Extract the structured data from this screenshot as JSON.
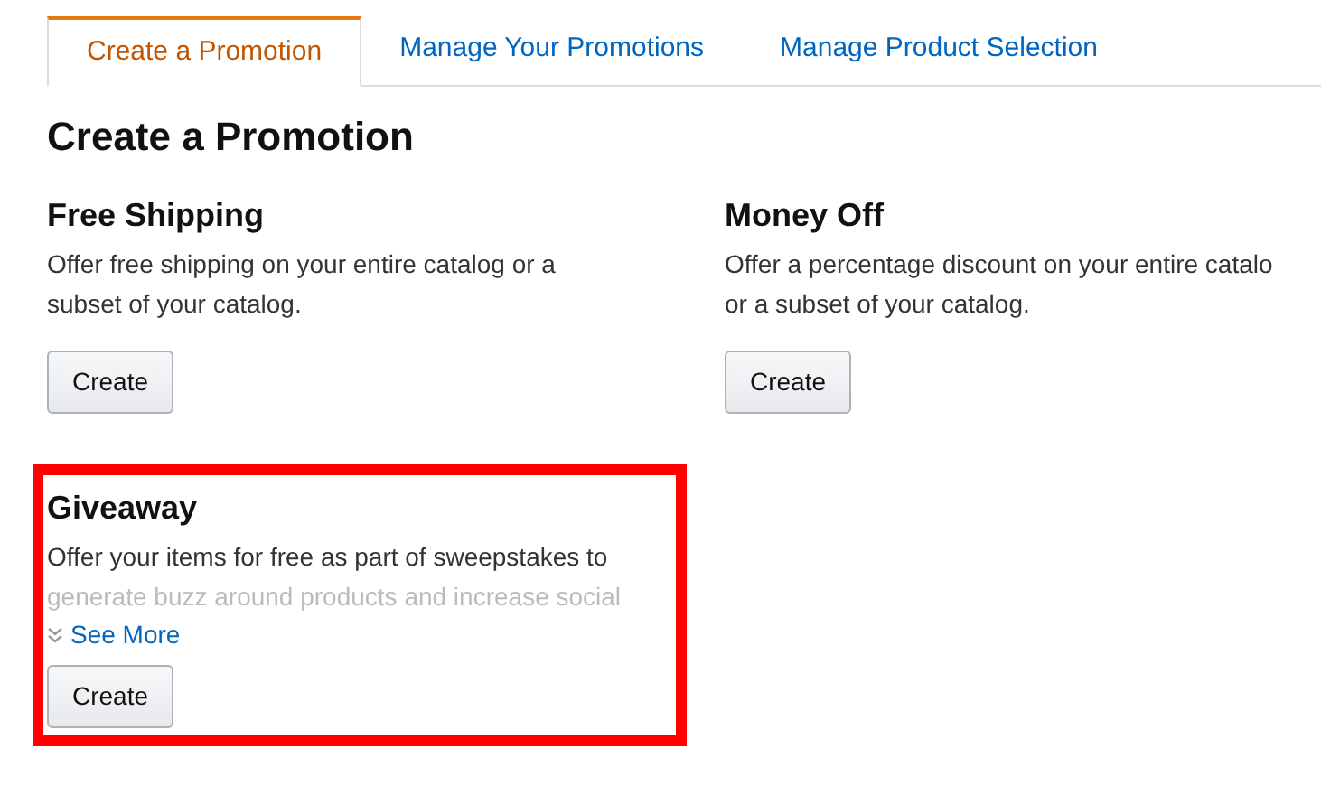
{
  "tabs": [
    {
      "label": "Create a Promotion",
      "selected": true
    },
    {
      "label": "Manage Your Promotions",
      "selected": false
    },
    {
      "label": "Manage Product Selection",
      "selected": false
    }
  ],
  "heading": "Create a Promotion",
  "promotions": [
    {
      "title": "Free Shipping",
      "lines": [
        "Offer free shipping on your entire catalog or a",
        "subset of your catalog."
      ],
      "faded_last_line": false,
      "button": "Create",
      "highlighted": false
    },
    {
      "title": "Money Off",
      "lines": [
        "Offer a percentage discount on your entire catalo",
        "or a subset of your catalog."
      ],
      "faded_last_line": false,
      "button": "Create",
      "highlighted": false
    },
    {
      "title": "Giveaway",
      "lines": [
        "Offer your items for free as part of sweepstakes to",
        "generate buzz around products and increase social"
      ],
      "faded_last_line": true,
      "see_more": "See More",
      "button": "Create",
      "highlighted": true
    }
  ]
}
